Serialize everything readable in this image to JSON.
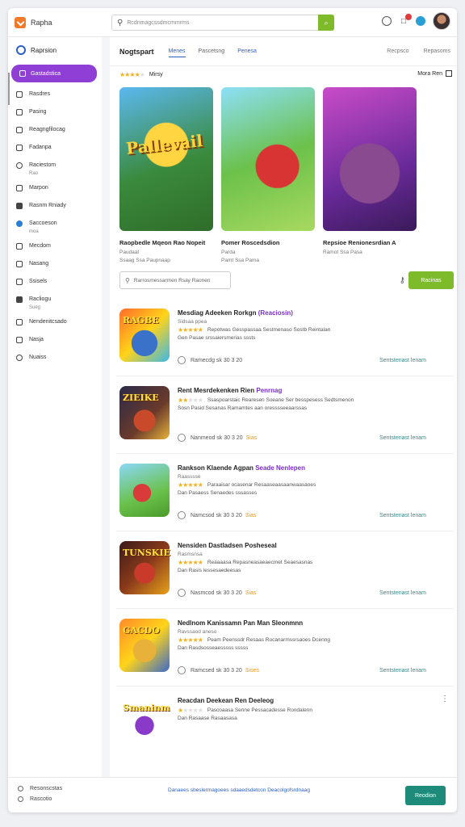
{
  "app": {
    "brand": "Rapha"
  },
  "search": {
    "placeholder": "Rcdnmagcssdmcmmrms",
    "button_icon": "search-icon"
  },
  "topbar": {
    "icons": [
      "clock-icon",
      "bell-icon",
      "globe-icon",
      "avatar"
    ]
  },
  "sidebar": {
    "header": "Raprsion",
    "active": "Gastadstica",
    "items": [
      {
        "label": "Rasdres",
        "icon": "square-icon"
      },
      {
        "label": "Pasing",
        "icon": "square-icon"
      },
      {
        "label": "Reagngfilocag",
        "icon": "user-icon"
      },
      {
        "label": "Fadanpa",
        "icon": "calendar-icon"
      },
      {
        "label": "Raciestom",
        "sub": "Rao",
        "icon": "chat-icon"
      },
      {
        "label": "Marpon",
        "icon": "window-icon"
      },
      {
        "label": "Rasnm Rniady",
        "icon": "folder-icon"
      },
      {
        "label": "Saccoeson",
        "sub": "moa",
        "icon": "radio-icon"
      },
      {
        "label": "Mecdom",
        "icon": "check-icon"
      },
      {
        "label": "Nasang",
        "icon": "edit-icon"
      },
      {
        "label": "Ssisels",
        "icon": "copy-icon"
      },
      {
        "label": "Racliogu",
        "sub": "Sueg",
        "icon": "people-icon"
      },
      {
        "label": "Nendenitcsado",
        "icon": "checkbox-icon"
      },
      {
        "label": "Nasja",
        "icon": "flag-icon"
      },
      {
        "label": "Nuaiss",
        "icon": "circle-icon"
      }
    ]
  },
  "main": {
    "title": "Nogtspart",
    "tabs": [
      "Menes",
      "Pascetsng",
      "Penesa"
    ],
    "right_tabs": [
      "Recpsco",
      "Repasoms"
    ],
    "rating_label": "Mirsy",
    "rating_stars": 4,
    "more_label": "Mora Ren",
    "featured": [
      {
        "art": "Pallevail",
        "title": "Raopbedle Mqeon Rao Nopeit",
        "subtitle": "Paudaat",
        "meta": "Ssaag  Ssa Paupnaap"
      },
      {
        "art": "",
        "title": "Pomer Roscedsdion",
        "subtitle": "Parda",
        "meta": "Pamt  Ssa  Pama"
      },
      {
        "art": "",
        "title": "Repsioe Renionesrdian A",
        "subtitle": "",
        "meta": "Ramot  Ssa Pasa"
      }
    ],
    "filter": {
      "placeholder": "Rarrosmessarmen Rsay Raonen",
      "button": "Racinas"
    },
    "list": [
      {
        "art": "RAGBE",
        "title_a": "Mesdiag Adeeken Rorkgn",
        "title_b": "(Reaciosin)",
        "meta": "Sidsaa ppea",
        "stars": 5,
        "ratings": "Repotwas Gesspassaa Sestmenaso Sostb Reintalan",
        "desc": "Gen Pasae srssaiersmerias sssts",
        "price_line": "Ramecdg sk 30 3 20",
        "price": "",
        "action": "Sentstenast lenam"
      },
      {
        "art": "ZIEIKE",
        "title_a": "Rent Mesrdekenken Rien",
        "title_b": "Penrnag",
        "meta": "",
        "stars": 2,
        "ratings": "Ssaspoarstaic  Rearesen Soeane  Ser besspesess Sedtsmenon",
        "desc": "Sosn Pasid Sesanas Ramamtes aan oresssseeaarssas",
        "price_line": "Nanmeod sk 30 3 20",
        "price": "Sias",
        "action": "Sentstenast lenam"
      },
      {
        "art": "",
        "title_a": "Rankson Klaende Agpan",
        "title_b": "Seade Nenlepen",
        "meta": "Raasssse",
        "stars": 5,
        "ratings": "Paraaisar ocasenar Resaaseaasaanwaasaoes",
        "desc": "Dan Pasaess Senaedes sssasses",
        "price_line": "Namcsod sk 30 3 20",
        "price": "Sias",
        "action": "Sentstenast lenam"
      },
      {
        "art": "TUNSKIE",
        "title_a": "Nensiden Dastladsen Posheseal",
        "title_b": "",
        "meta": "Rasmsnsa",
        "stars": 5,
        "ratings": "Reaaaasa Repasneasaeaecmet Seaesasnas",
        "desc": "Dan Rasis lessesaedeesas",
        "price_line": "Nasmcod sk 30 3 20",
        "price": "Sias",
        "action": "Sentstenast lenam"
      },
      {
        "art": "GACDO",
        "title_a": "Nedlnom Kanissamn Pan Man Sleonmnn",
        "title_b": "",
        "meta": "Ravssaod aneso",
        "stars": 5,
        "ratings": "Peam Peenssdr Resaas Rocanarmssrsaoes Dcenng",
        "desc": "Dan Rasdsosseaesssss sssss",
        "price_line": "Ramcsed sk 30 3 20",
        "price": "Sises",
        "action": "Sentstenast lenam"
      },
      {
        "art": "Smaninm",
        "title_a": "Reacdan Deekean Ren Deeleog",
        "title_b": "",
        "meta": "",
        "stars": 1,
        "ratings": "Pascoaasa Senne Pessacadesse Rondalenn",
        "desc": "Dan Rasaase Rasaasasa",
        "price_line": "",
        "price": "",
        "action": ""
      }
    ]
  },
  "bottombar": {
    "left": [
      "Resonscstas",
      "Rascotio"
    ],
    "center": "Danaees sbeslermagoees sdaaedsdetcon Deacolgofsrdnaag",
    "button": "Reodion"
  },
  "colors": {
    "accent_purple": "#8f3fd6",
    "green": "#7dbb2b",
    "teal": "#1e8a7a",
    "blue": "#2a5fc9"
  }
}
